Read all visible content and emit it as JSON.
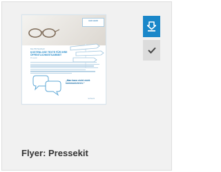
{
  "item": {
    "title": "Flyer: Pressekit"
  },
  "flyer": {
    "logo_text": "netz werk",
    "small_line": "Das PR-Handbuch",
    "headline": "KOSTENLOSE TEXTE FÜR IHRE ÖFFENTLICHKEITSARBEIT",
    "subline": "Pressekit",
    "quote": "„Man kann nicht nicht kommunizieren.“",
    "footer": "netzwerk"
  },
  "actions": {
    "download_icon": "download-icon",
    "select_icon": "checkmark-icon"
  },
  "colors": {
    "accent": "#1a87c9",
    "card_bg": "#f1f1f1",
    "check_bg": "#dcdcdc"
  }
}
